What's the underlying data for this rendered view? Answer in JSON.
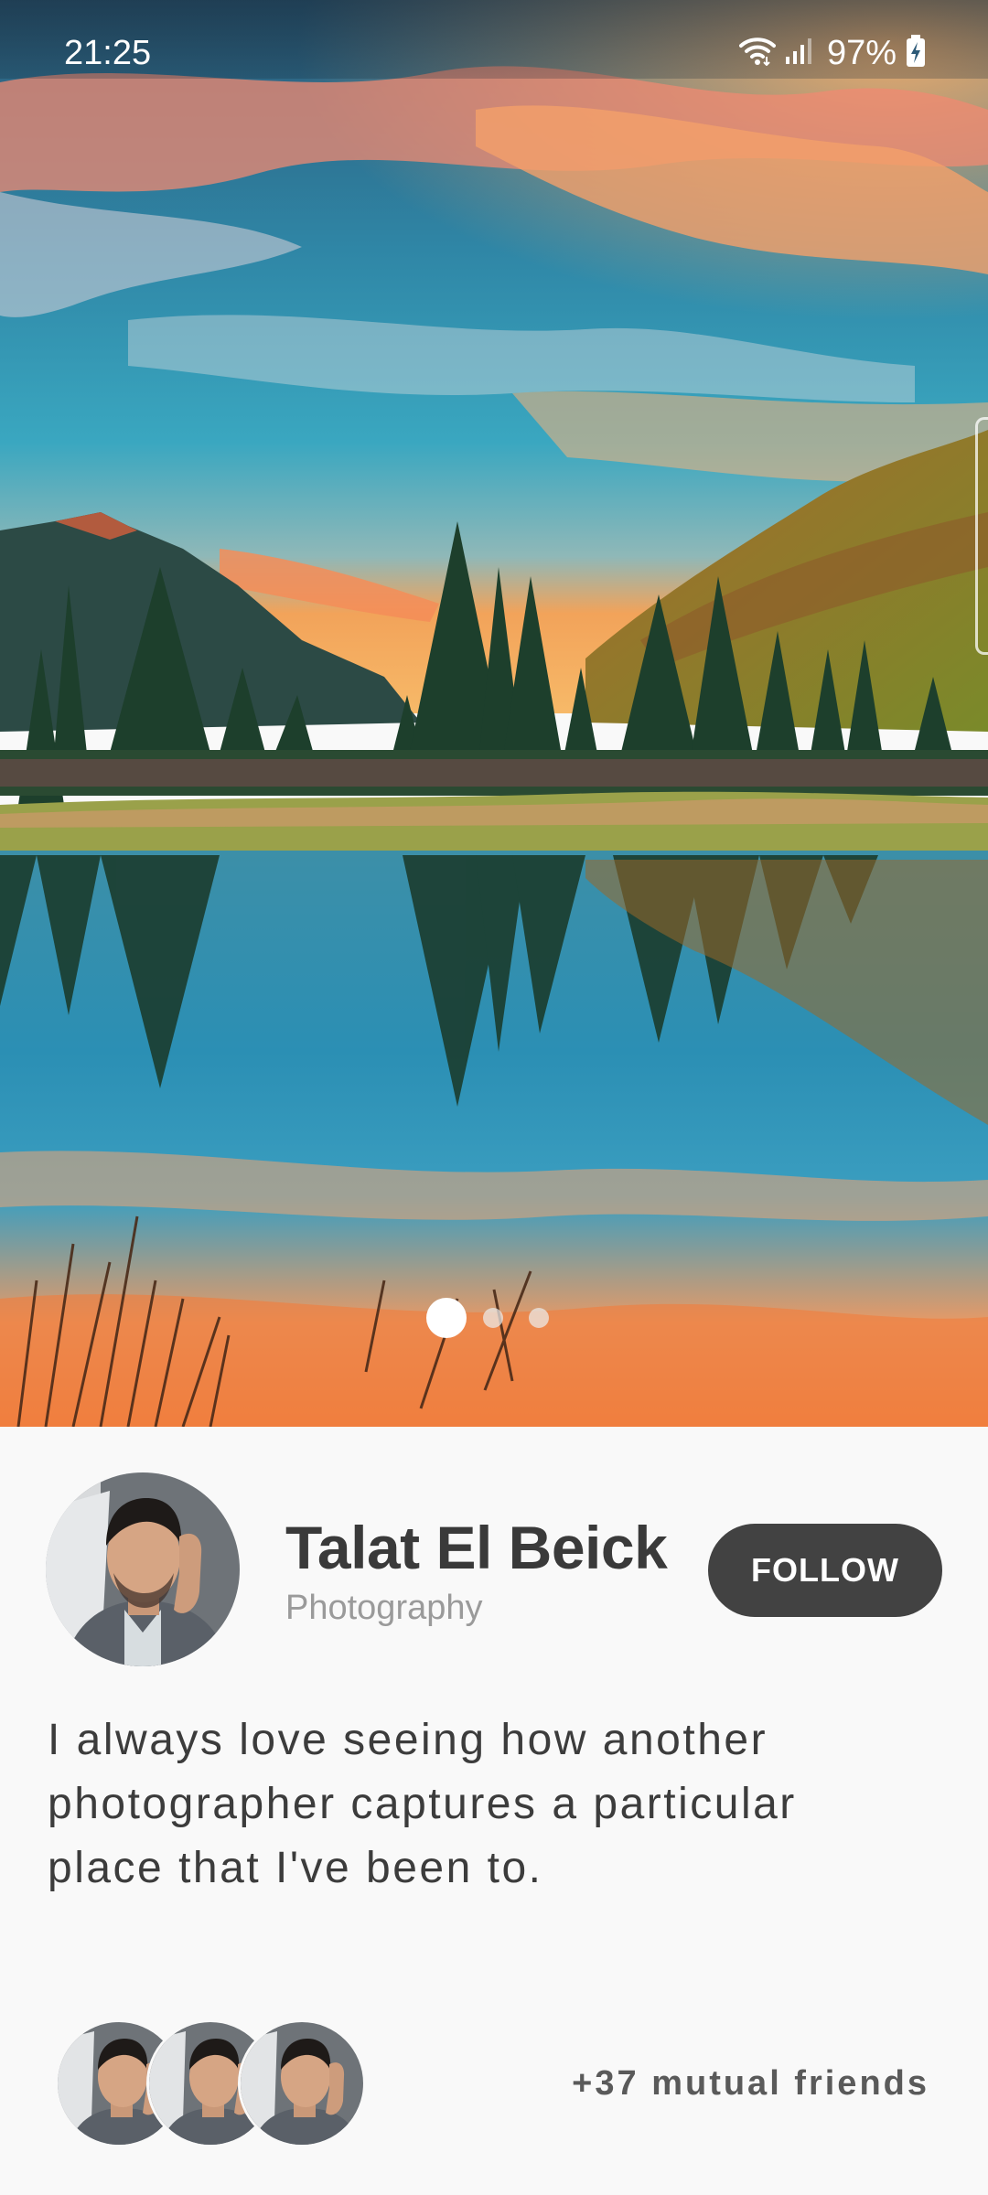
{
  "status_bar": {
    "time": "21:25",
    "battery_percent": "97%",
    "icons": [
      "wifi-icon",
      "signal-icon",
      "battery-charging-icon"
    ]
  },
  "hero": {
    "image_subject": "mountain lake landscape at sunset",
    "pager": {
      "page_count": 3,
      "active_index": 0
    }
  },
  "profile": {
    "name": "Talat El Beick",
    "category": "Photography",
    "follow_label": "FOLLOW",
    "bio": "I always love seeing how another photographer captures a particular place that I've been to.",
    "mutual_friends_label": "+37 mutual friends"
  },
  "colors": {
    "background": "#f9f9f9",
    "follow_button": "#424242",
    "name_text": "#3a3a3a",
    "category_text": "#9a9a9a"
  }
}
